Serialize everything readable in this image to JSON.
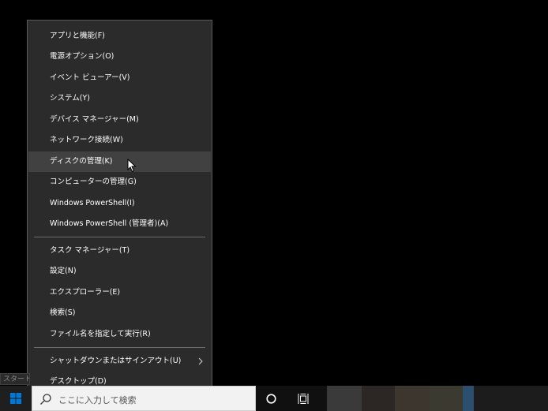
{
  "menu": {
    "items": [
      {
        "label": "アプリと機能(F)"
      },
      {
        "label": "電源オプション(O)"
      },
      {
        "label": "イベント ビューアー(V)"
      },
      {
        "label": "システム(Y)"
      },
      {
        "label": "デバイス マネージャー(M)"
      },
      {
        "label": "ネットワーク接続(W)"
      },
      {
        "label": "ディスクの管理(K)"
      },
      {
        "label": "コンピューターの管理(G)"
      },
      {
        "label": "Windows PowerShell(I)"
      },
      {
        "label": "Windows PowerShell (管理者)(A)"
      },
      {
        "label": "タスク マネージャー(T)"
      },
      {
        "label": "設定(N)"
      },
      {
        "label": "エクスプローラー(E)"
      },
      {
        "label": "検索(S)"
      },
      {
        "label": "ファイル名を指定して実行(R)"
      },
      {
        "label": "シャットダウンまたはサインアウト(U)"
      },
      {
        "label": "デスクトップ(D)"
      }
    ],
    "hovered_item": "ディスクの管理(K)"
  },
  "tooltip": {
    "text": "スタート"
  },
  "taskbar": {
    "search_placeholder": "ここに入力して検索",
    "icons": [
      "windows-logo-icon",
      "search-icon",
      "cortana-circle-icon",
      "task-view-icon"
    ]
  },
  "colors": {
    "menu_bg": "#2b2b2b",
    "menu_hover": "#414141",
    "menu_text": "#ffffff",
    "separator": "#6a6a6a",
    "taskbar_bg": "#101010",
    "search_bg": "#f2f2f2",
    "windows_blue": "#0078d7"
  }
}
